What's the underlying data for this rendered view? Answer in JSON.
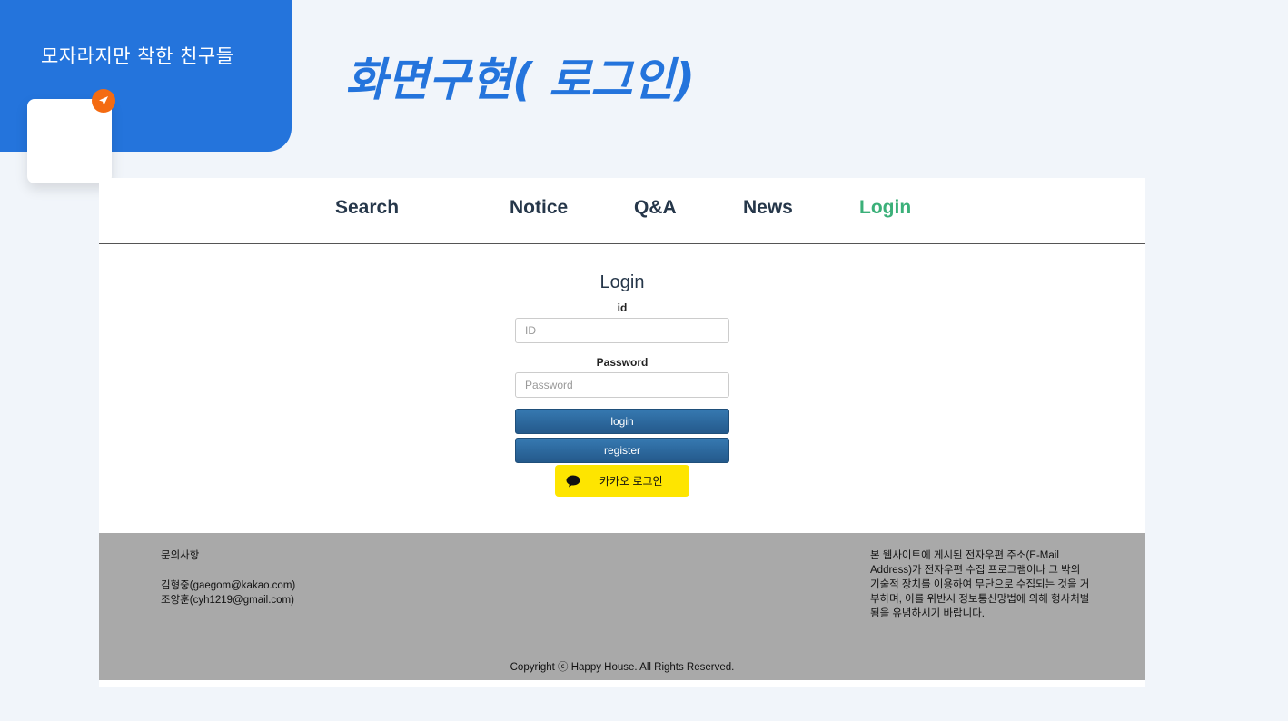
{
  "slide": {
    "brand_title": "모자라지만 착한 친구들",
    "title": "화면구현( 로그인)",
    "badge_color": "#f46b12",
    "accent_color": "#2474dc"
  },
  "nav": {
    "items": [
      {
        "label": "Search"
      },
      {
        "label": "Notice"
      },
      {
        "label": "Q&A"
      },
      {
        "label": "News"
      },
      {
        "label": "Login",
        "active": true
      }
    ],
    "active_color": "#3bb079"
  },
  "login": {
    "heading": "Login",
    "id_label": "id",
    "id_placeholder": "ID",
    "password_label": "Password",
    "password_placeholder": "Password",
    "login_button": "login",
    "register_button": "register",
    "kakao_button": "카카오 로그인",
    "kakao_color": "#fee500"
  },
  "footer": {
    "contact_title": "문의사항",
    "contacts": [
      "김형중(gaegom@kakao.com)",
      "조양훈(cyh1219@gmail.com)"
    ],
    "notice": "본 웹사이트에 게시된 전자우편 주소(E-Mail Address)가 전자우편 수집 프로그램이나 그 밖의 기술적 장치를 이용하여 무단으로 수집되는 것을 거부하며, 이를 위반시 정보통신망법에 의해 형사처벌됨을 유념하시기 바랍니다.",
    "copyright": "Copyright ⓒ Happy House. All Rights Reserved."
  }
}
